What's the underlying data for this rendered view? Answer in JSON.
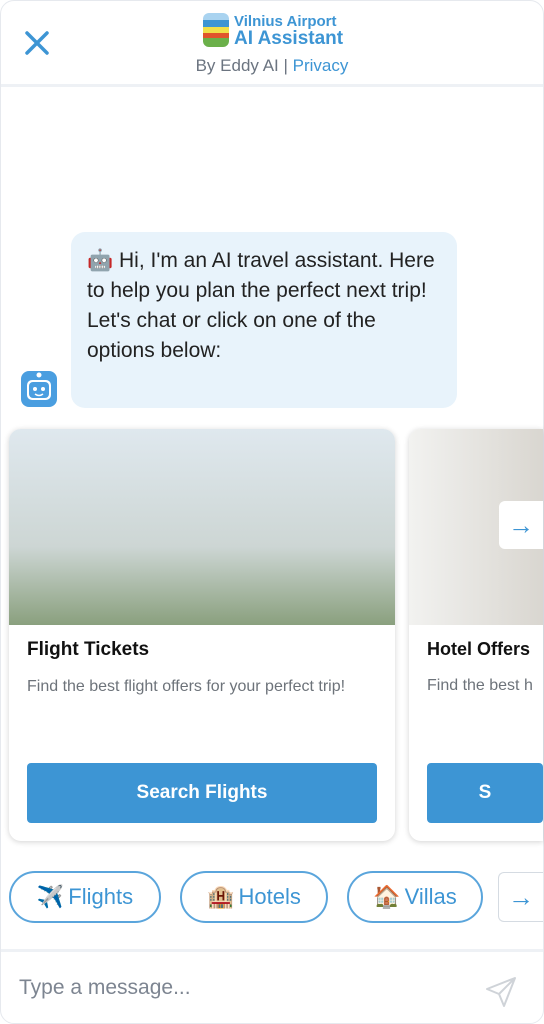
{
  "header": {
    "brand_line1": "Vilnius Airport",
    "brand_line2": "AI Assistant",
    "by": "By Eddy AI",
    "separator": "|",
    "privacy": "Privacy"
  },
  "message": {
    "icon": "🤖",
    "text": "Hi, I'm an AI travel assistant. Here to help you plan the perfect next trip! Let's chat or click on one of the options below:"
  },
  "cards": [
    {
      "title": "Flight Tickets",
      "description": "Find the best flight offers for your perfect trip!",
      "button": "Search Flights"
    },
    {
      "title": "Hotel Offers",
      "description": "Find the best h",
      "button": "S"
    }
  ],
  "quick_replies": [
    {
      "emoji": "✈️",
      "label": "Flights"
    },
    {
      "emoji": "🏨",
      "label": "Hotels"
    },
    {
      "emoji": "🏠",
      "label": "Villas"
    }
  ],
  "input": {
    "placeholder": "Type a message..."
  },
  "colors": {
    "accent": "#3d95d4",
    "bubble": "#e8f3fb"
  }
}
